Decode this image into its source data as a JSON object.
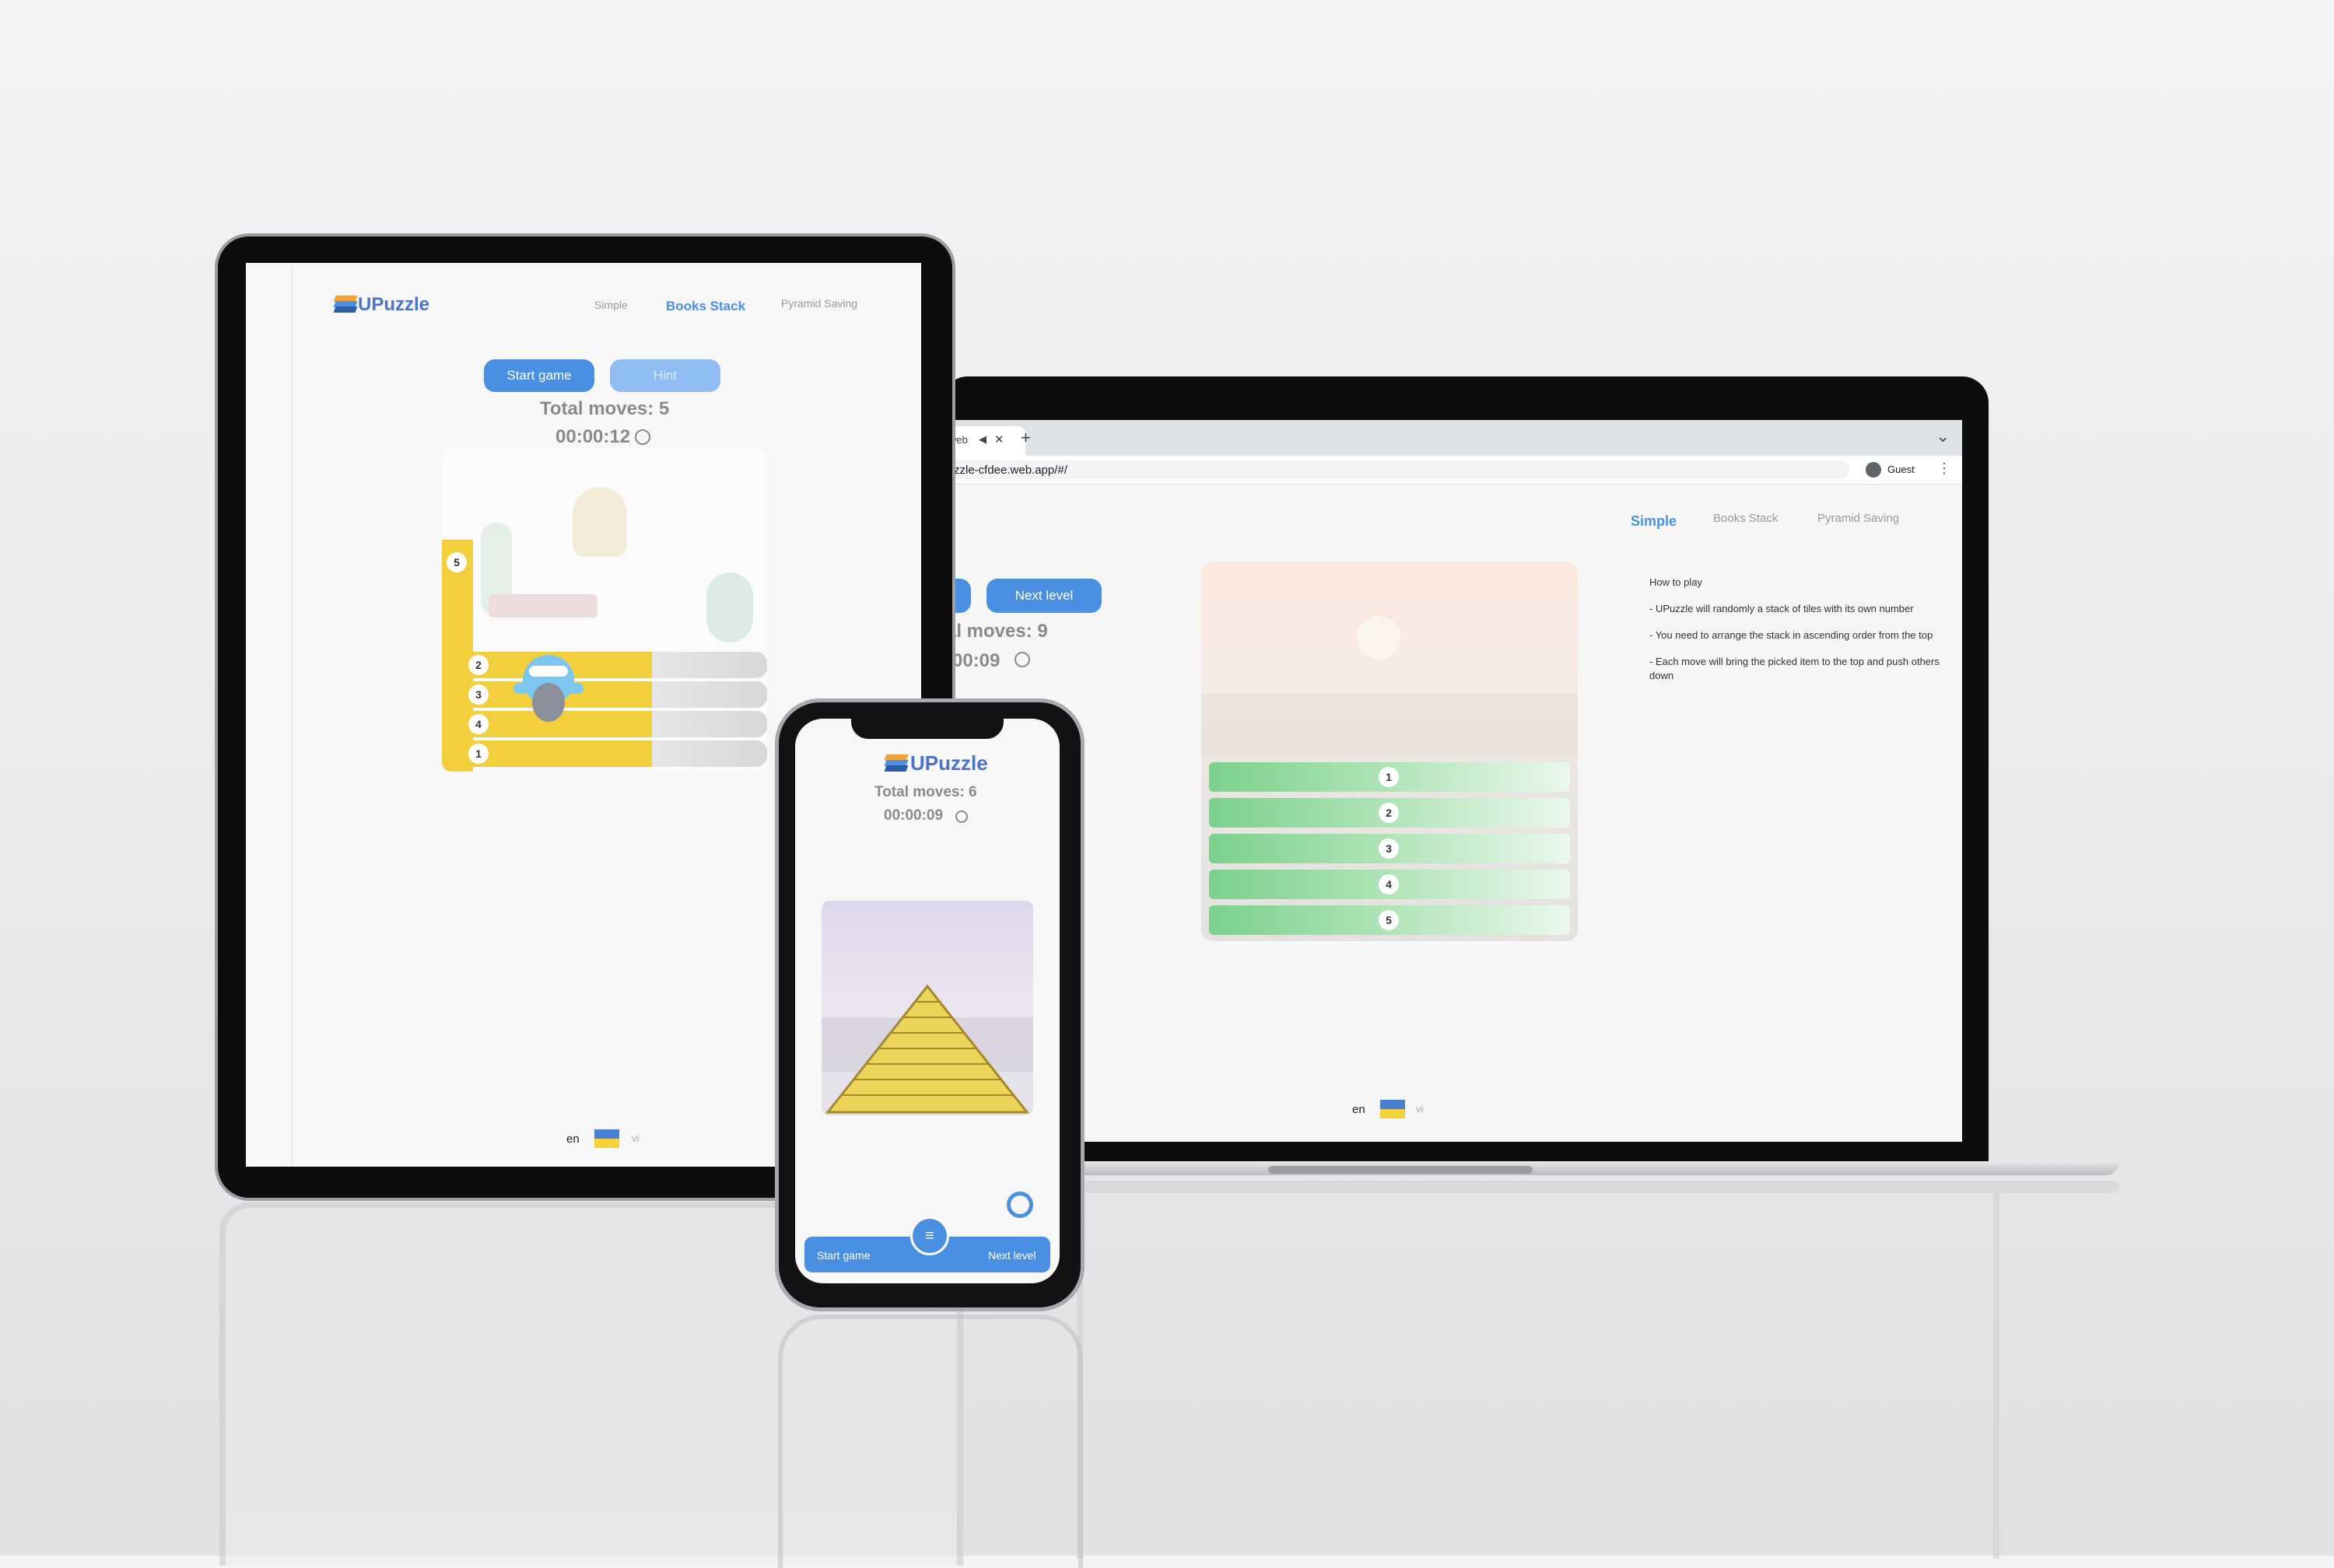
{
  "app": {
    "brand": "UPuzzle"
  },
  "colors": {
    "accent": "#4a90e2",
    "tile_green": "#7bd18c",
    "book_yellow": "#f2cf3c",
    "pyramid_yellow": "#ecd35a"
  },
  "laptop": {
    "browser": {
      "tab_title": "web",
      "tab_icons": [
        "speaker-icon",
        "close-icon"
      ],
      "new_tab_symbol": "+",
      "url": "zzle-cfdee.web.app/#/",
      "profile_label": "Guest",
      "menu_symbol": "⋮",
      "chevron_symbol": "⌄"
    },
    "nav": {
      "simple": "Simple",
      "books_stack": "Books Stack",
      "pyramid_saving": "Pyramid Saving"
    },
    "next_level_label": "Next level",
    "total_moves": "al moves: 9",
    "timer": ":00:09",
    "tiles": [
      "1",
      "2",
      "3",
      "4",
      "5"
    ],
    "how_to_play": {
      "title": "How to play",
      "rule1": "- UPuzzle will randomly a stack of tiles with its own number",
      "rule2": "- You need to arrange the stack in ascending order from the top",
      "rule3": "- Each move will bring the picked item to the top and push others down"
    },
    "lang": {
      "en": "en",
      "vi": "vi"
    }
  },
  "tablet": {
    "nav": {
      "simple": "Simple",
      "books_stack": "Books Stack",
      "pyramid_saving": "Pyramid Saving"
    },
    "start_game_label": "Start game",
    "hint_label": "Hint",
    "total_moves": "Total moves: 5",
    "timer": "00:00:12",
    "books": [
      "2",
      "3",
      "4",
      "1"
    ],
    "top_book": "5",
    "lang": {
      "en": "en",
      "vi": "vi"
    }
  },
  "phone": {
    "total_moves": "Total moves: 6",
    "timer": "00:00:09",
    "start_game_label": "Start game",
    "next_level_label": "Next level",
    "menu_symbol": "≡"
  }
}
